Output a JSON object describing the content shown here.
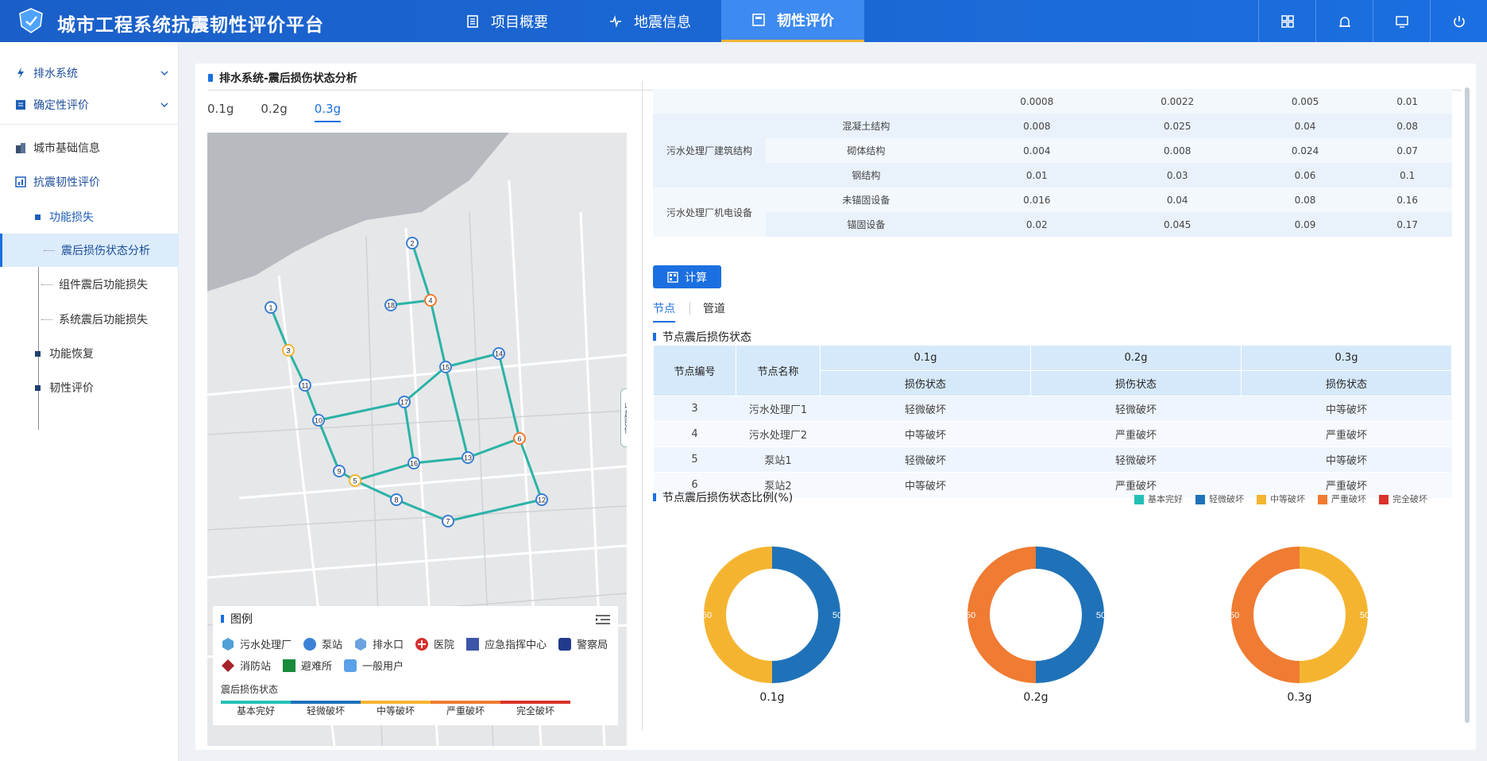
{
  "app": {
    "title": "城市工程系统抗震韧性评价平台"
  },
  "nav": [
    "项目概要",
    "地震信息",
    "韧性评价"
  ],
  "sidebar": {
    "groups": [
      "排水系统",
      "确定性评价"
    ],
    "items": [
      "城市基础信息",
      "抗震韧性评价"
    ],
    "sub": [
      "功能损失",
      "震后损伤状态分析",
      "组件震后功能损失",
      "系统震后功能损失",
      "功能恢复",
      "韧性评价"
    ]
  },
  "main": {
    "title": "排水系统-震后损伤状态分析",
    "pga_tabs": [
      "0.1g",
      "0.2g",
      "0.3g"
    ],
    "collapse_label": "收起图例"
  },
  "top_table": {
    "rows": [
      [
        "",
        "",
        "0.0008",
        "0.0022",
        "0.005",
        "0.01"
      ],
      [
        "污水处理厂建筑结构",
        "混凝土结构",
        "0.008",
        "0.025",
        "0.04",
        "0.08"
      ],
      [
        "",
        "砌体结构",
        "0.004",
        "0.008",
        "0.024",
        "0.07"
      ],
      [
        "",
        "钢结构",
        "0.01",
        "0.03",
        "0.06",
        "0.1"
      ],
      [
        "污水处理厂机电设备",
        "未锚固设备",
        "0.016",
        "0.04",
        "0.08",
        "0.16"
      ],
      [
        "",
        "锚固设备",
        "0.02",
        "0.045",
        "0.09",
        "0.17"
      ]
    ]
  },
  "calc_label": "计算",
  "subtabs": [
    "节点",
    "管道"
  ],
  "node_section": {
    "title": "节点震后损伤状态",
    "headers": {
      "id": "节点编号",
      "name": "节点名称",
      "pga": [
        "0.1g",
        "0.2g",
        "0.3g"
      ],
      "state": "损伤状态"
    },
    "rows": [
      [
        "3",
        "污水处理厂1",
        "轻微破坏",
        "轻微破坏",
        "中等破坏"
      ],
      [
        "4",
        "污水处理厂2",
        "中等破坏",
        "严重破坏",
        "严重破坏"
      ],
      [
        "5",
        "泵站1",
        "轻微破坏",
        "轻微破坏",
        "中等破坏"
      ],
      [
        "6",
        "泵站2",
        "中等破坏",
        "严重破坏",
        "严重破坏"
      ]
    ]
  },
  "ratio_section": {
    "title": "节点震后损伤状态比例(%)"
  },
  "damage_states": [
    {
      "label": "基本完好",
      "color": "#22c1b4"
    },
    {
      "label": "轻微破坏",
      "color": "#1f72b8"
    },
    {
      "label": "中等破坏",
      "color": "#f5b430"
    },
    {
      "label": "严重破坏",
      "color": "#f07b32"
    },
    {
      "label": "完全破坏",
      "color": "#d9332b"
    }
  ],
  "map_legend": {
    "title": "图例",
    "entries": [
      "污水处理厂",
      "泵站",
      "排水口",
      "医院",
      "应急指挥中心",
      "警察局",
      "消防站",
      "避难所",
      "一般用户"
    ],
    "damage_title": "震后损伤状态"
  },
  "chart_data": [
    {
      "type": "pie",
      "title": "0.1g",
      "categories": [
        "轻微破坏",
        "中等破坏"
      ],
      "values": [
        50,
        50
      ]
    },
    {
      "type": "pie",
      "title": "0.2g",
      "categories": [
        "轻微破坏",
        "严重破坏"
      ],
      "values": [
        50,
        50
      ]
    },
    {
      "type": "pie",
      "title": "0.3g",
      "categories": [
        "中等破坏",
        "严重破坏"
      ],
      "values": [
        50,
        50
      ]
    }
  ],
  "map_nodes": [
    "1",
    "2",
    "3",
    "4",
    "5",
    "6",
    "7",
    "8",
    "9",
    "10",
    "11",
    "12",
    "13",
    "14",
    "15",
    "16",
    "17",
    "18"
  ]
}
